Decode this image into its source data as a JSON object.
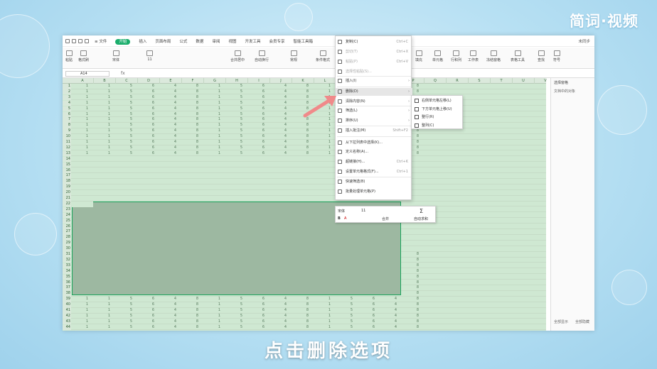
{
  "brand": "简词·视频",
  "caption": "点击删除选项",
  "app": {
    "menu": [
      "≡ 文件",
      "开始",
      "插入",
      "页面布局",
      "公式",
      "数据",
      "审阅",
      "视图",
      "开发工具",
      "会员专享",
      "智能工具箱"
    ],
    "active_menu": "开始",
    "user": "未同步",
    "ribbon": [
      {
        "label": "粘贴"
      },
      {
        "label": "格式刷"
      },
      {
        "label": "宋体"
      },
      {
        "label": "11"
      },
      {
        "label": "合并居中"
      },
      {
        "label": "自动换行"
      },
      {
        "label": "常规"
      },
      {
        "label": "条件格式"
      },
      {
        "label": "填充"
      },
      {
        "label": "单元格"
      },
      {
        "label": "行和列"
      },
      {
        "label": "工作表"
      },
      {
        "label": "冻结窗格"
      },
      {
        "label": "表格工具"
      },
      {
        "label": "查找"
      },
      {
        "label": "符号"
      }
    ],
    "name_box": "A14",
    "fx": "fx"
  },
  "sheet": {
    "columns": [
      "A",
      "B",
      "C",
      "D",
      "E",
      "F",
      "G",
      "H",
      "I",
      "J",
      "K",
      "L",
      "M",
      "N",
      "O",
      "P",
      "Q",
      "R",
      "S",
      "T",
      "U",
      "V"
    ],
    "row_values": [
      "1",
      "1",
      "5",
      "6",
      "4",
      "8",
      "1",
      "5",
      "6",
      "4",
      "8",
      "1",
      "5",
      "6",
      "4",
      "8"
    ],
    "rows_top": [
      1,
      2,
      3,
      4,
      5,
      6,
      7,
      8,
      9,
      10,
      11,
      12,
      13
    ],
    "rows_selected": [
      14,
      15,
      16,
      17,
      18,
      19,
      20,
      21,
      22,
      23,
      24,
      25,
      26,
      27,
      28,
      29,
      30
    ],
    "rows_bottom": [
      31,
      32,
      33,
      34,
      35,
      36,
      37,
      38,
      39,
      40,
      41,
      42,
      43,
      44
    ]
  },
  "context_menu": [
    {
      "label": "复制(C)",
      "shortcut": "Ctrl+C"
    },
    {
      "label": "剪切(T)",
      "shortcut": "Ctrl+X"
    },
    {
      "label": "粘贴(P)",
      "shortcut": "Ctrl+V"
    },
    {
      "label": "选择性粘贴(S)...",
      "shortcut": ""
    },
    {
      "label": "插入(I)",
      "shortcut": ""
    },
    {
      "label": "删除(D)",
      "shortcut": ""
    },
    {
      "label": "清除内容(N)",
      "shortcut": ""
    },
    {
      "label": "筛选(L)",
      "shortcut": ""
    },
    {
      "label": "排序(U)",
      "shortcut": ""
    },
    {
      "label": "插入批注(M)",
      "shortcut": "Shift+F2"
    },
    {
      "label": "从下拉列表中选择(K)...",
      "shortcut": ""
    },
    {
      "label": "定义名称(A)...",
      "shortcut": ""
    },
    {
      "label": "超链接(H)...",
      "shortcut": "Ctrl+K"
    },
    {
      "label": "设置单元格格式(F)...",
      "shortcut": "Ctrl+1"
    },
    {
      "label": "快速筛选(B)",
      "shortcut": ""
    },
    {
      "label": "批量处理单元格(P)",
      "shortcut": ""
    }
  ],
  "submenu": [
    "右侧单元格左移(L)",
    "下方单元格上移(U)",
    "整行(R)",
    "整列(C)"
  ],
  "mini_toolbar": {
    "font": "宋体",
    "size": "11",
    "merge": "合并",
    "sum": "自动求和"
  },
  "right_pane": {
    "title": "选择窗格",
    "subtitle": "文档中的对象",
    "bottom": "全部显示",
    "bottom2": "全部隐藏"
  }
}
